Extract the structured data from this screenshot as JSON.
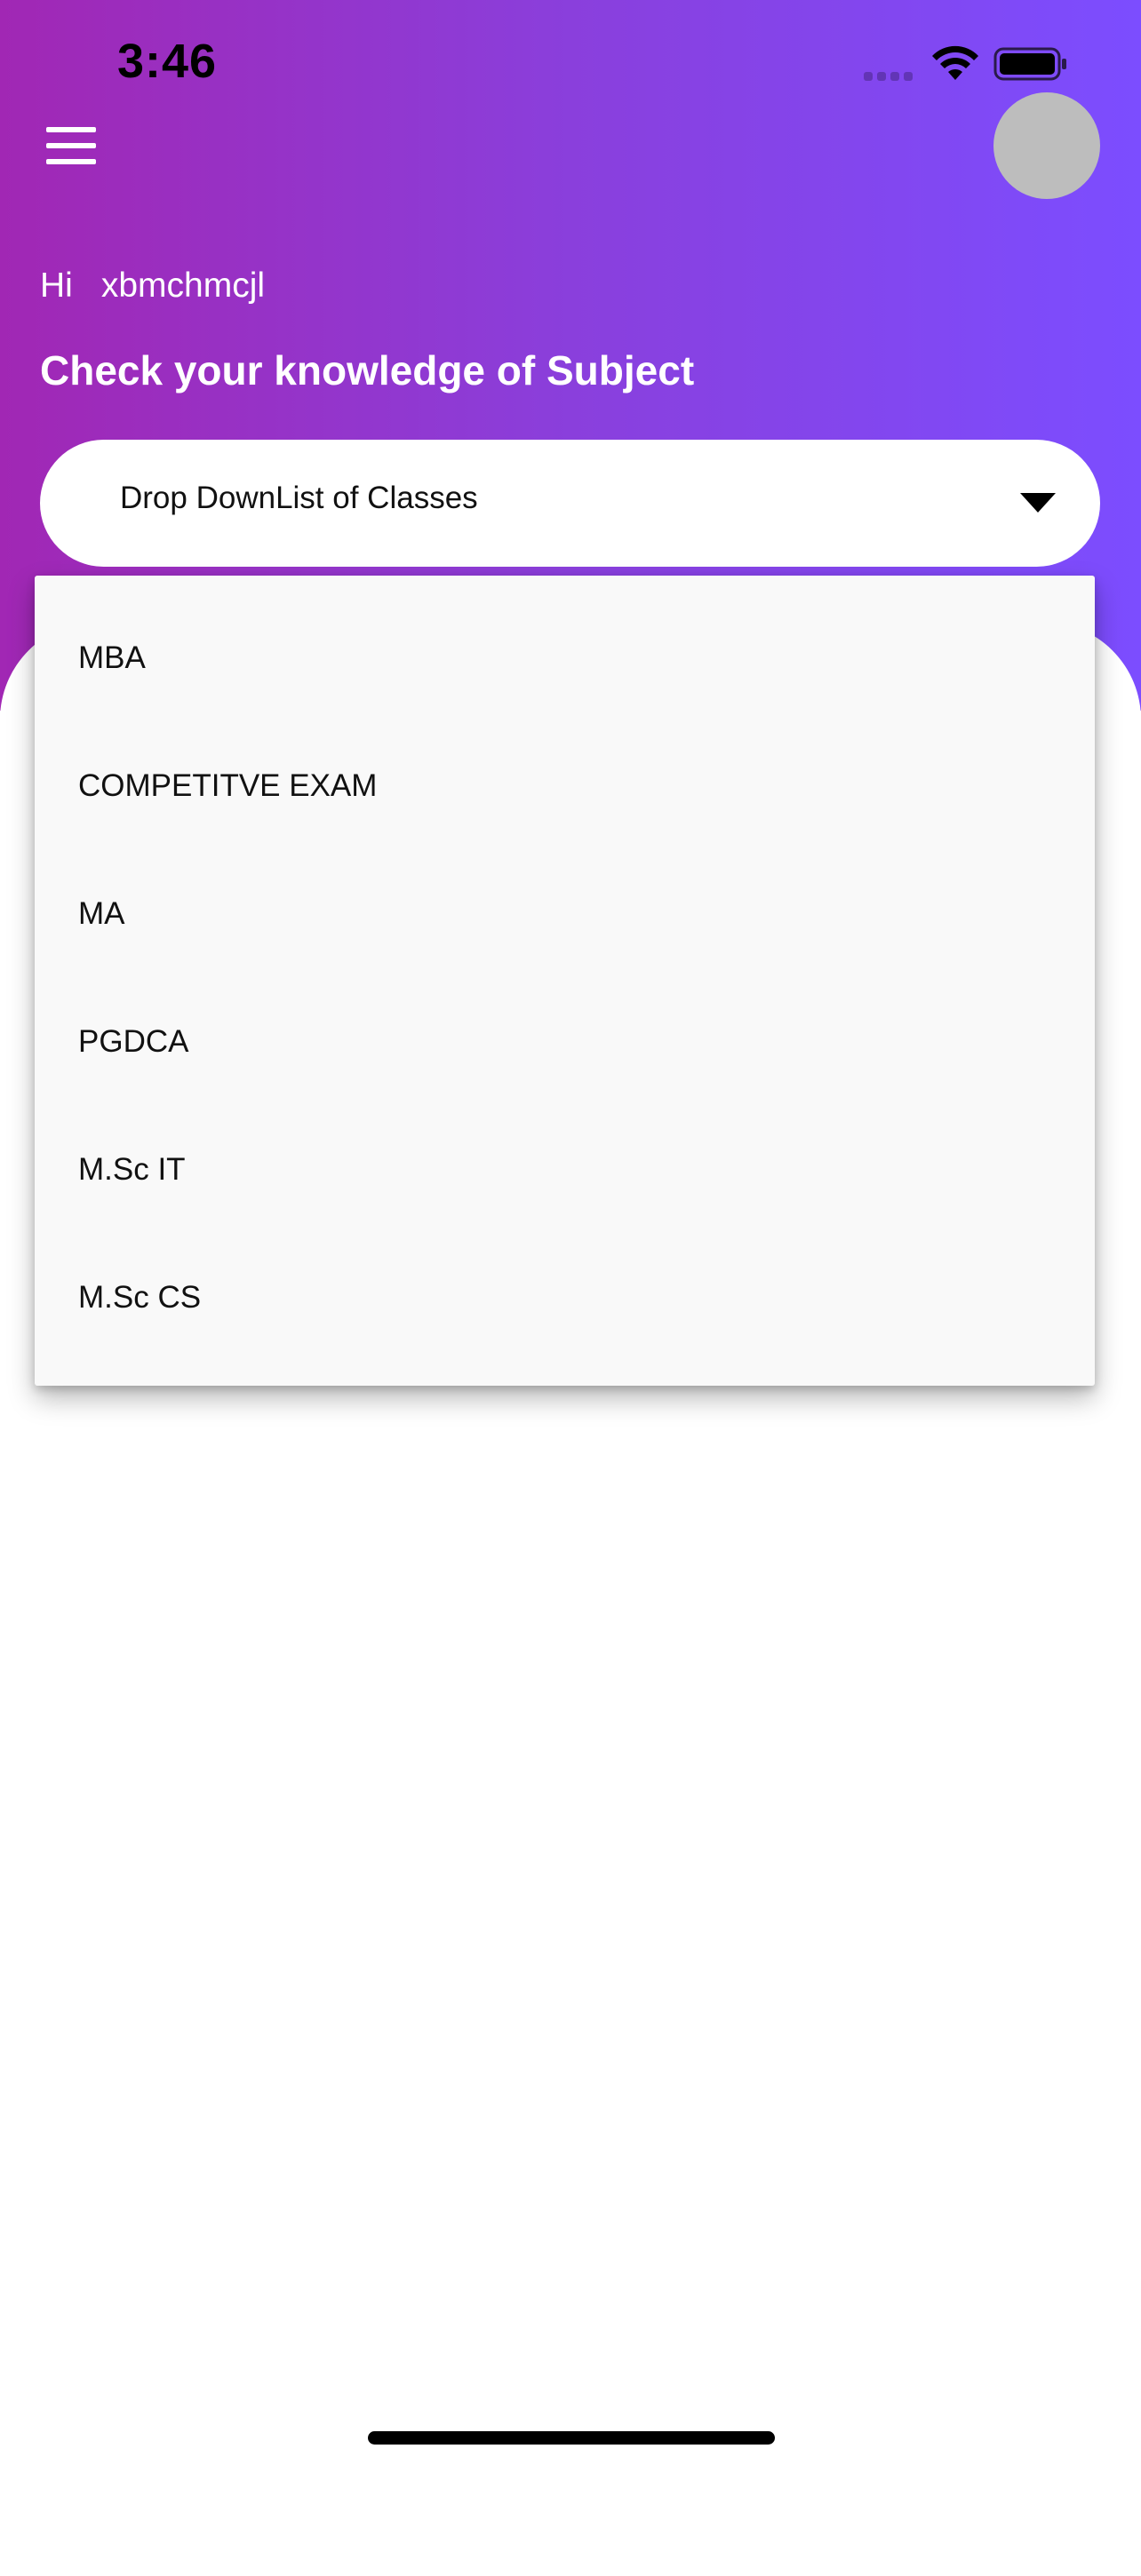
{
  "status_bar": {
    "time": "3:46"
  },
  "header": {
    "menu_icon": "hamburger-menu-icon",
    "greeting_prefix": "Hi",
    "user_name": "xbmchmcjl",
    "headline": "Check your knowledge of Subject"
  },
  "dropdown": {
    "placeholder": "Drop DownList of Classes",
    "icon": "dropdown-caret-icon",
    "options": [
      {
        "label": "MBA"
      },
      {
        "label": "COMPETITVE EXAM"
      },
      {
        "label": "MA"
      },
      {
        "label": "PGDCA"
      },
      {
        "label": "M.Sc IT"
      },
      {
        "label": "M.Sc CS"
      }
    ]
  },
  "colors": {
    "gradient_start": "#a127b4",
    "gradient_end": "#7c4dff",
    "avatar": "#bdbdbd",
    "menu_background": "#f9f9f9"
  }
}
